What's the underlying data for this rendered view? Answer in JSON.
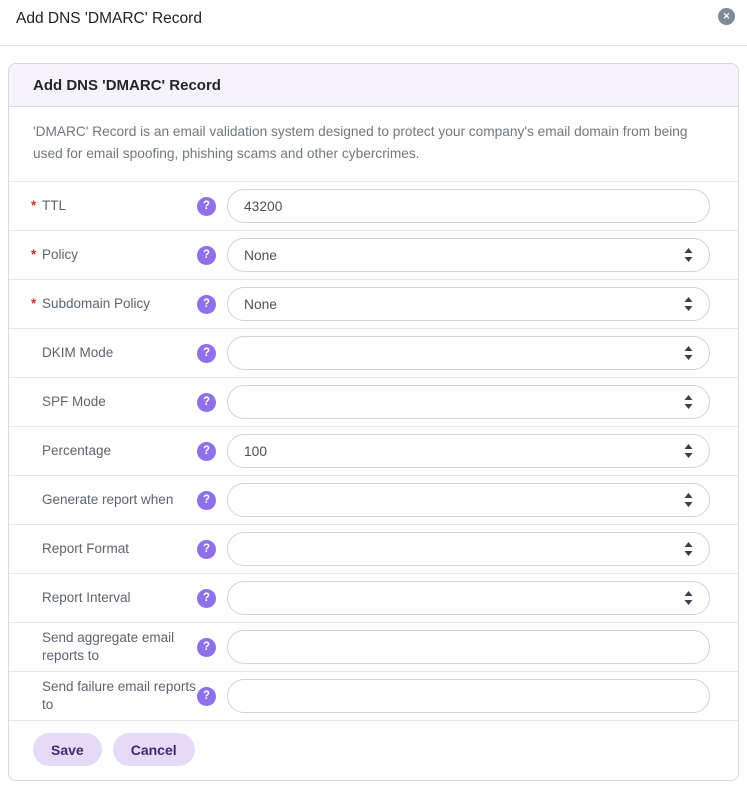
{
  "modal": {
    "title": "Add DNS 'DMARC' Record"
  },
  "icons": {
    "close": "✕",
    "help": "?"
  },
  "card": {
    "title": "Add DNS 'DMARC' Record",
    "description": "'DMARC' Record is an email validation system designed to protect your company's email domain from being used for email spoofing, phishing scams and other cybercrimes.",
    "rows": [
      {
        "label": "TTL",
        "required": true,
        "control": "input",
        "value": "43200"
      },
      {
        "label": "Policy",
        "required": true,
        "control": "select",
        "value": "None"
      },
      {
        "label": "Subdomain Policy",
        "required": true,
        "control": "select",
        "value": "None"
      },
      {
        "label": "DKIM Mode",
        "required": false,
        "control": "select",
        "value": ""
      },
      {
        "label": "SPF Mode",
        "required": false,
        "control": "select",
        "value": ""
      },
      {
        "label": "Percentage",
        "required": false,
        "control": "select",
        "value": "100"
      },
      {
        "label": "Generate report when",
        "required": false,
        "control": "select",
        "value": ""
      },
      {
        "label": "Report Format",
        "required": false,
        "control": "select",
        "value": ""
      },
      {
        "label": "Report Interval",
        "required": false,
        "control": "select",
        "value": ""
      },
      {
        "label": "Send aggregate email reports to",
        "required": false,
        "control": "input",
        "value": ""
      },
      {
        "label": "Send failure email reports to",
        "required": false,
        "control": "input",
        "value": ""
      }
    ],
    "buttons": {
      "save": "Save",
      "cancel": "Cancel"
    }
  },
  "colors": {
    "accent_purple": "#8e70e8",
    "required_red": "#cb2f2f",
    "card_header_bg": "#f7f3fb",
    "card_border": "#d8d9de",
    "row_divider": "#e6e8ea",
    "button_bg": "#e6dbf7",
    "button_text": "#3d2b72",
    "close_circle": "#7f8c98"
  }
}
